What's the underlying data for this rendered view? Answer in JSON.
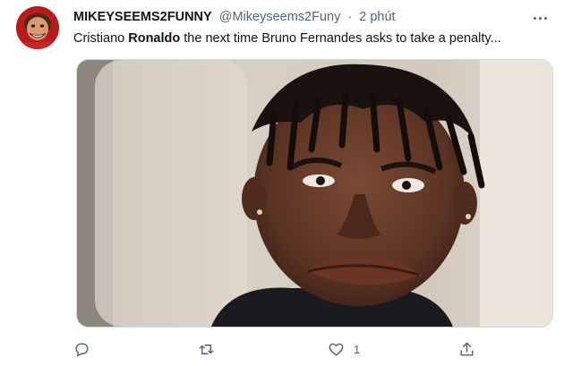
{
  "tweet": {
    "display_name": "MIKEYSEEMS2FUNNY",
    "handle": "@Mikeyseems2Funy",
    "separator": "·",
    "time": "2 phút",
    "text_segments": [
      {
        "text": "Cristiano ",
        "bold": false
      },
      {
        "text": "Ronaldo",
        "bold": true
      },
      {
        "text": " the next time Bruno Fernandes asks to take a penalty...",
        "bold": false
      }
    ]
  },
  "actions": {
    "reply_icon": "reply-icon",
    "retweet_icon": "retweet-icon",
    "like_icon": "like-icon",
    "like_count": "1",
    "share_icon": "share-icon"
  },
  "colors": {
    "text_primary": "#0f1419",
    "text_secondary": "#536471",
    "border": "#cfd9de"
  }
}
